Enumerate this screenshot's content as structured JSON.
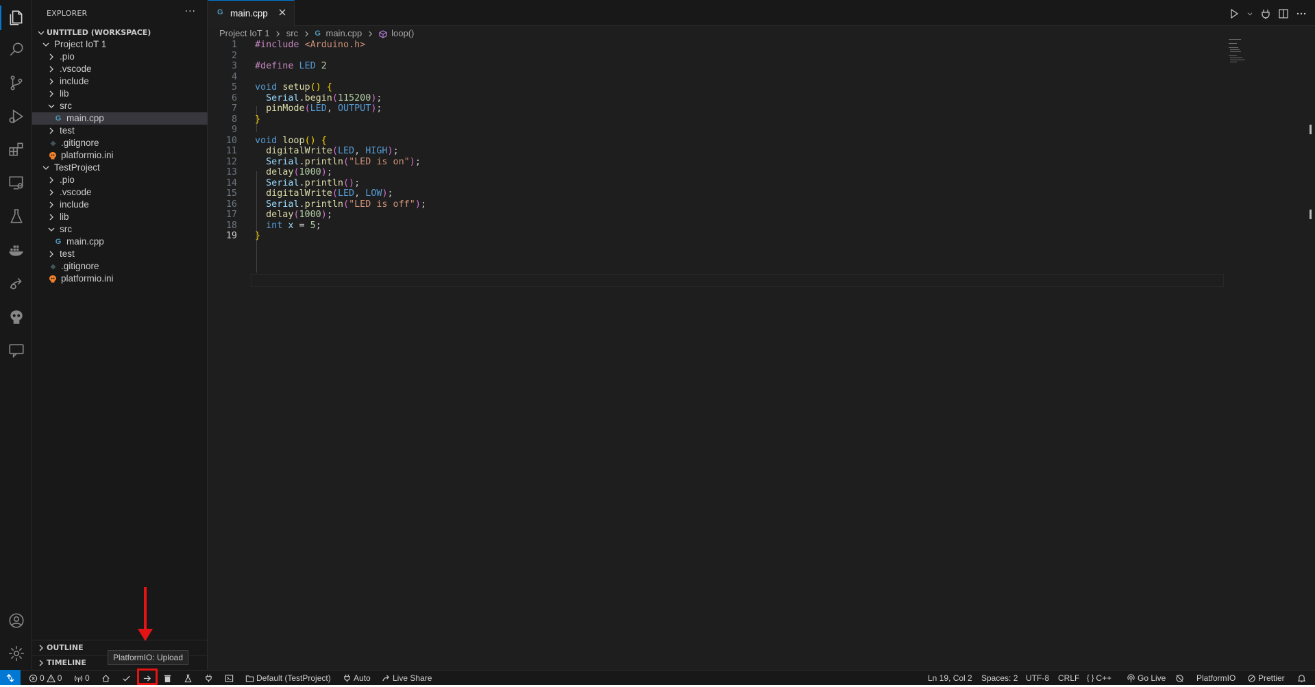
{
  "explorer": {
    "title": "EXPLORER",
    "more_label": "···",
    "workspace_label": "UNTITLED (WORKSPACE)",
    "tree": [
      {
        "label": "Project IoT 1",
        "depth": 0,
        "kind": "folder-open"
      },
      {
        "label": ".pio",
        "depth": 1,
        "kind": "folder"
      },
      {
        "label": ".vscode",
        "depth": 1,
        "kind": "folder"
      },
      {
        "label": "include",
        "depth": 1,
        "kind": "folder"
      },
      {
        "label": "lib",
        "depth": 1,
        "kind": "folder"
      },
      {
        "label": "src",
        "depth": 1,
        "kind": "folder-open"
      },
      {
        "label": "main.cpp",
        "depth": 2,
        "kind": "cpp",
        "selected": true
      },
      {
        "label": "test",
        "depth": 1,
        "kind": "folder"
      },
      {
        "label": ".gitignore",
        "depth": 1,
        "kind": "git"
      },
      {
        "label": "platformio.ini",
        "depth": 1,
        "kind": "pio"
      },
      {
        "label": "TestProject",
        "depth": 0,
        "kind": "folder-open"
      },
      {
        "label": ".pio",
        "depth": 1,
        "kind": "folder"
      },
      {
        "label": ".vscode",
        "depth": 1,
        "kind": "folder"
      },
      {
        "label": "include",
        "depth": 1,
        "kind": "folder"
      },
      {
        "label": "lib",
        "depth": 1,
        "kind": "folder"
      },
      {
        "label": "src",
        "depth": 1,
        "kind": "folder-open"
      },
      {
        "label": "main.cpp",
        "depth": 2,
        "kind": "cpp"
      },
      {
        "label": "test",
        "depth": 1,
        "kind": "folder"
      },
      {
        "label": ".gitignore",
        "depth": 1,
        "kind": "git"
      },
      {
        "label": "platformio.ini",
        "depth": 1,
        "kind": "pio"
      }
    ],
    "outline_label": "OUTLINE",
    "timeline_label": "TIMELINE"
  },
  "editor": {
    "tab_label": "main.cpp",
    "tab_icon_glyph": "G",
    "breadcrumb": [
      "Project IoT 1",
      "src",
      "main.cpp",
      "loop()"
    ],
    "current_line": 19,
    "lines": [
      [
        [
          "#include ",
          "pp"
        ],
        [
          "<Arduino.h>",
          "str"
        ]
      ],
      [],
      [
        [
          "#define ",
          "pp"
        ],
        [
          "LED ",
          "mac"
        ],
        [
          "2",
          "num"
        ]
      ],
      [],
      [
        [
          "void ",
          "kw"
        ],
        [
          "setup",
          "fn"
        ],
        [
          "() ",
          "br1"
        ],
        [
          "{",
          "br1"
        ]
      ],
      [
        [
          "  "
        ],
        [
          "Serial",
          "var"
        ],
        [
          "."
        ],
        [
          "begin",
          "fn"
        ],
        [
          "(",
          "br2"
        ],
        [
          "115200",
          "num"
        ],
        [
          ")",
          "br2"
        ],
        [
          ";"
        ]
      ],
      [
        [
          "  "
        ],
        [
          "pinMode",
          "fn"
        ],
        [
          "(",
          "br2"
        ],
        [
          "LED",
          "mac"
        ],
        [
          ", "
        ],
        [
          "OUTPUT",
          "mac"
        ],
        [
          ")",
          "br2"
        ],
        [
          ";"
        ]
      ],
      [
        [
          "}",
          "br1"
        ]
      ],
      [],
      [
        [
          "void ",
          "kw"
        ],
        [
          "loop",
          "fn"
        ],
        [
          "() ",
          "br1"
        ],
        [
          "{",
          "br1"
        ]
      ],
      [
        [
          "  "
        ],
        [
          "digitalWrite",
          "fn"
        ],
        [
          "(",
          "br2"
        ],
        [
          "LED",
          "mac"
        ],
        [
          ", "
        ],
        [
          "HIGH",
          "mac"
        ],
        [
          ")",
          "br2"
        ],
        [
          ";"
        ]
      ],
      [
        [
          "  "
        ],
        [
          "Serial",
          "var"
        ],
        [
          "."
        ],
        [
          "println",
          "fn"
        ],
        [
          "(",
          "br2"
        ],
        [
          "\"LED is on\"",
          "str"
        ],
        [
          ")",
          "br2"
        ],
        [
          ";"
        ]
      ],
      [
        [
          "  "
        ],
        [
          "delay",
          "fn"
        ],
        [
          "(",
          "br2"
        ],
        [
          "1000",
          "num"
        ],
        [
          ")",
          "br2"
        ],
        [
          ";"
        ]
      ],
      [
        [
          "  "
        ],
        [
          "Serial",
          "var"
        ],
        [
          "."
        ],
        [
          "println",
          "fn"
        ],
        [
          "()",
          "br2"
        ],
        [
          ";"
        ]
      ],
      [
        [
          "  "
        ],
        [
          "digitalWrite",
          "fn"
        ],
        [
          "(",
          "br2"
        ],
        [
          "LED",
          "mac"
        ],
        [
          ", "
        ],
        [
          "LOW",
          "mac"
        ],
        [
          ")",
          "br2"
        ],
        [
          ";"
        ]
      ],
      [
        [
          "  "
        ],
        [
          "Serial",
          "var"
        ],
        [
          "."
        ],
        [
          "println",
          "fn"
        ],
        [
          "(",
          "br2"
        ],
        [
          "\"LED is off\"",
          "str"
        ],
        [
          ")",
          "br2"
        ],
        [
          ";"
        ]
      ],
      [
        [
          "  "
        ],
        [
          "delay",
          "fn"
        ],
        [
          "(",
          "br2"
        ],
        [
          "1000",
          "num"
        ],
        [
          ")",
          "br2"
        ],
        [
          ";"
        ]
      ],
      [
        [
          "  "
        ],
        [
          "int ",
          "kw"
        ],
        [
          "x",
          "var"
        ],
        [
          " = "
        ],
        [
          "5",
          "num"
        ],
        [
          ";"
        ]
      ],
      [
        [
          "}",
          "br1"
        ]
      ]
    ]
  },
  "tooltip": {
    "text": "PlatformIO: Upload"
  },
  "statusbar": {
    "errors": "0",
    "warnings": "0",
    "ports": "0",
    "env": "Default (TestProject)",
    "auto": "Auto",
    "live_share": "Live Share",
    "position": "Ln 19, Col 2",
    "spaces": "Spaces: 2",
    "encoding": "UTF-8",
    "eol": "CRLF",
    "language": "C++",
    "go_live": "Go Live",
    "platformio": "PlatformIO",
    "prettier": "Prettier"
  },
  "colors": {
    "accent": "#0078d4",
    "annotation": "#e51414"
  }
}
